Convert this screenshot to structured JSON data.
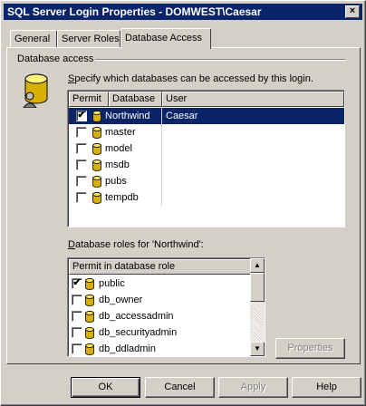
{
  "window": {
    "title": "SQL Server Login Properties - DOMWEST\\Caesar",
    "close_glyph": "×"
  },
  "tabs": [
    {
      "label": "General"
    },
    {
      "label": "Server Roles"
    },
    {
      "label": "Database Access"
    }
  ],
  "database_access": {
    "group_label": "Database access",
    "instruction_prefix": "S",
    "instruction_rest": "pecify which databases can be accessed by this login.",
    "columns": [
      "Permit",
      "Database",
      "User"
    ],
    "rows": [
      {
        "permit": "✔",
        "database": "Northwind",
        "user": "Caesar",
        "selected": true
      },
      {
        "permit": "",
        "database": "master",
        "user": ""
      },
      {
        "permit": "",
        "database": "model",
        "user": ""
      },
      {
        "permit": "",
        "database": "msdb",
        "user": ""
      },
      {
        "permit": "",
        "database": "pubs",
        "user": ""
      },
      {
        "permit": "",
        "database": "tempdb",
        "user": ""
      }
    ]
  },
  "roles": {
    "label_prefix": "D",
    "label_rest": "atabase roles for 'Northwind':",
    "column": "Permit in database role",
    "rows": [
      {
        "permit": "✔",
        "role": "public"
      },
      {
        "permit": "",
        "role": "db_owner"
      },
      {
        "permit": "",
        "role": "db_accessadmin"
      },
      {
        "permit": "",
        "role": "db_securityadmin"
      },
      {
        "permit": "",
        "role": "db_ddladmin"
      }
    ],
    "scroll_up": "▲",
    "scroll_down": "▼",
    "properties_label": "Properties"
  },
  "buttons": {
    "ok": "OK",
    "cancel": "Cancel",
    "apply": "Apply",
    "help": "Help"
  },
  "colors": {
    "selection": "#0a246a",
    "face": "#d4d0c8",
    "db_icon": "#e8c000"
  }
}
